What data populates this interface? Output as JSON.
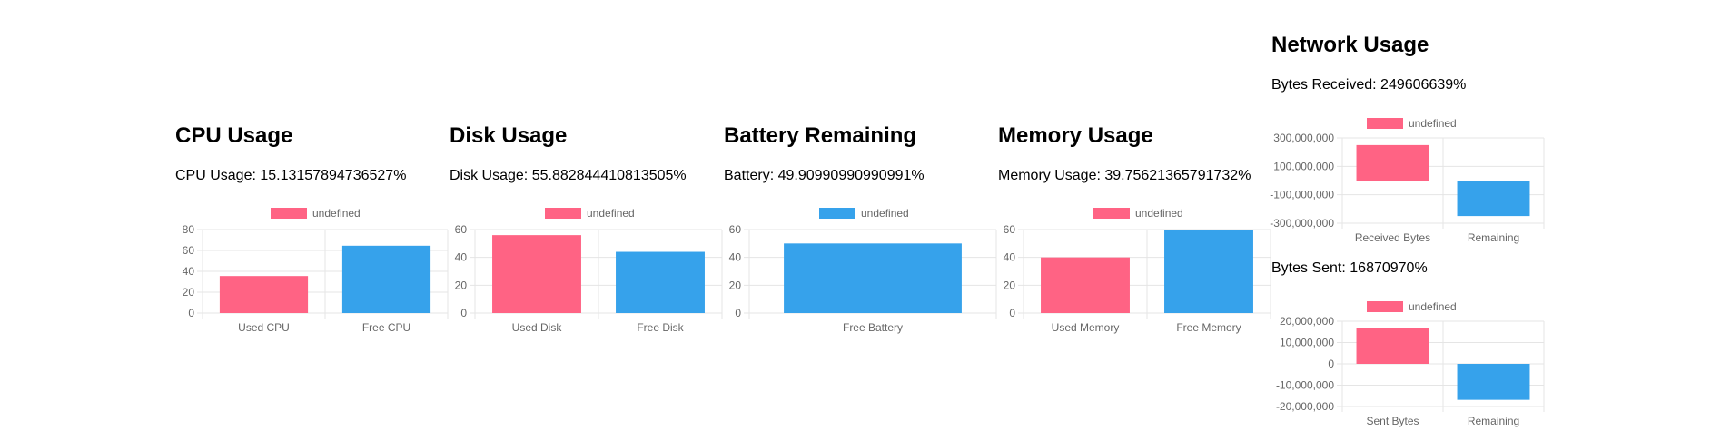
{
  "colors": {
    "used": "#ff6384",
    "free": "#36a2eb",
    "grid": "#e5e5e5",
    "tick": "#666666"
  },
  "panels": [
    {
      "title": "CPU Usage",
      "stat": "CPU Usage: 15.13157894736527%"
    },
    {
      "title": "Disk Usage",
      "stat": "Disk Usage: 55.882844410813505%"
    },
    {
      "title": "Battery Remaining",
      "stat": "Battery: 49.90990990990991%"
    },
    {
      "title": "Memory Usage",
      "stat": "Memory Usage: 39.75621365791732%"
    },
    {
      "title": "Network Usage",
      "stat": "Bytes Received: 249606639%",
      "stat2": "Bytes Sent: 16870970%"
    }
  ],
  "chart_data": [
    {
      "type": "bar",
      "legend": "undefined",
      "legend_color": "#ff6384",
      "categories": [
        "Used CPU",
        "Free CPU"
      ],
      "values": [
        35.5,
        64.5
      ],
      "colors": [
        "#ff6384",
        "#36a2eb"
      ],
      "ylim": [
        0,
        80
      ],
      "yticks": [
        0,
        20,
        40,
        60,
        80
      ],
      "ytick_labels": [
        "0",
        "20",
        "40",
        "60",
        "80"
      ],
      "grid": true,
      "legend_position": "top"
    },
    {
      "type": "bar",
      "legend": "undefined",
      "legend_color": "#ff6384",
      "categories": [
        "Used Disk",
        "Free Disk"
      ],
      "values": [
        56,
        44
      ],
      "colors": [
        "#ff6384",
        "#36a2eb"
      ],
      "ylim": [
        0,
        60
      ],
      "yticks": [
        0,
        20,
        40,
        60
      ],
      "ytick_labels": [
        "0",
        "20",
        "40",
        "60"
      ],
      "grid": true,
      "legend_position": "top"
    },
    {
      "type": "bar",
      "legend": "undefined",
      "legend_color": "#36a2eb",
      "categories": [
        "Free Battery"
      ],
      "values": [
        50
      ],
      "colors": [
        "#36a2eb"
      ],
      "ylim": [
        0,
        60
      ],
      "yticks": [
        0,
        20,
        40,
        60
      ],
      "ytick_labels": [
        "0",
        "20",
        "40",
        "60"
      ],
      "grid": true,
      "legend_position": "top"
    },
    {
      "type": "bar",
      "legend": "undefined",
      "legend_color": "#ff6384",
      "categories": [
        "Used Memory",
        "Free Memory"
      ],
      "values": [
        40,
        60
      ],
      "colors": [
        "#ff6384",
        "#36a2eb"
      ],
      "ylim": [
        0,
        60
      ],
      "yticks": [
        0,
        20,
        40,
        60
      ],
      "ytick_labels": [
        "0",
        "20",
        "40",
        "60"
      ],
      "grid": true,
      "legend_position": "top"
    },
    {
      "type": "bar",
      "legend": "undefined",
      "legend_color": "#ff6384",
      "categories": [
        "Received Bytes",
        "Remaining"
      ],
      "values": [
        249606639,
        -249606639
      ],
      "colors": [
        "#ff6384",
        "#36a2eb"
      ],
      "ylim": [
        -300000000,
        300000000
      ],
      "yticks": [
        -300000000,
        -100000000,
        100000000,
        300000000
      ],
      "ytick_labels": [
        "-300,000,000",
        "-100,000,000",
        "100,000,000",
        "300,000,000"
      ],
      "grid": true,
      "legend_position": "top"
    },
    {
      "type": "bar",
      "legend": "undefined",
      "legend_color": "#ff6384",
      "categories": [
        "Sent Bytes",
        "Remaining"
      ],
      "values": [
        16870970,
        -16870970
      ],
      "colors": [
        "#ff6384",
        "#36a2eb"
      ],
      "ylim": [
        -20000000,
        20000000
      ],
      "yticks": [
        -20000000,
        -10000000,
        0,
        10000000,
        20000000
      ],
      "ytick_labels": [
        "-20,000,000",
        "-10,000,000",
        "0",
        "10,000,000",
        "20,000,000"
      ],
      "grid": true,
      "legend_position": "top"
    }
  ]
}
